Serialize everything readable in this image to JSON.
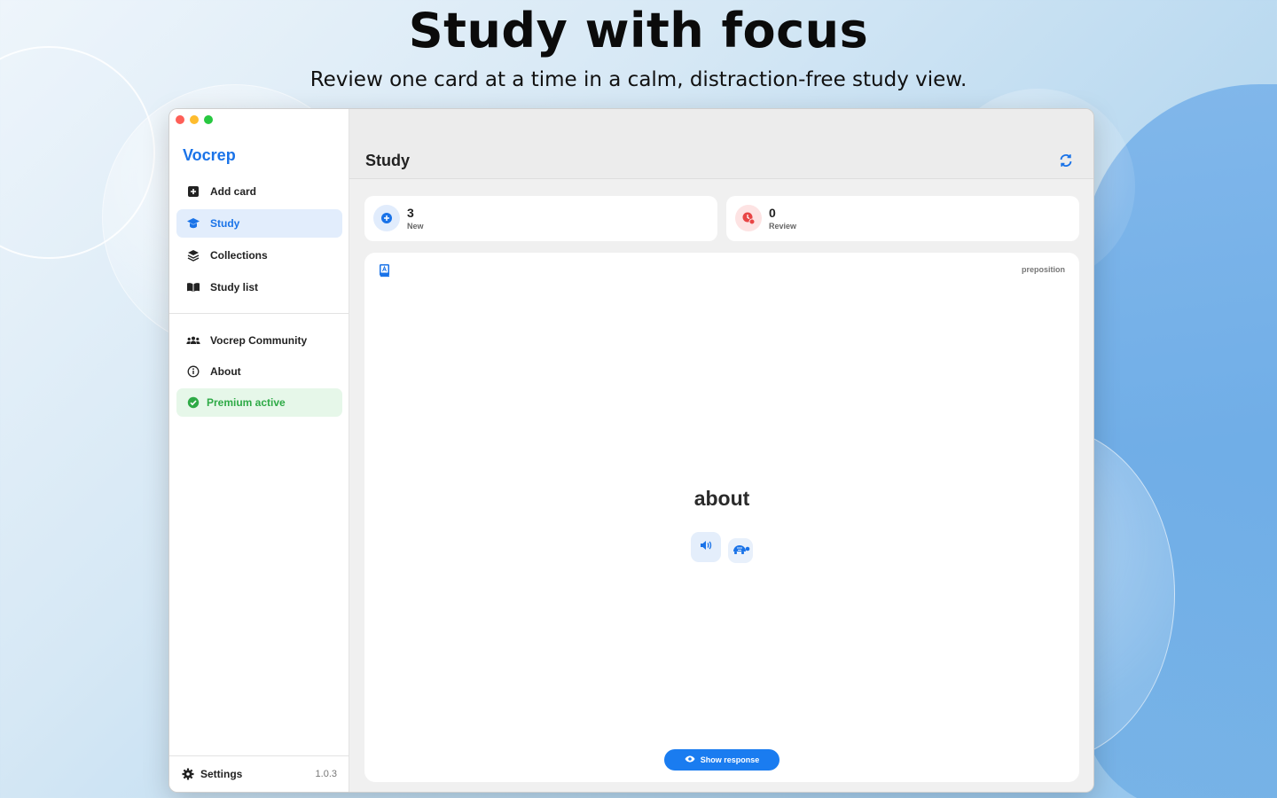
{
  "hero": {
    "title": "Study with focus",
    "subtitle": "Review one card at a time in a calm, distraction-free study view."
  },
  "sidebar": {
    "brand": "Vocrep",
    "items": [
      {
        "label": "Add card",
        "icon": "add-card-icon"
      },
      {
        "label": "Study",
        "icon": "graduation-cap-icon",
        "active": true
      },
      {
        "label": "Collections",
        "icon": "layers-icon"
      },
      {
        "label": "Study list",
        "icon": "open-book-icon"
      }
    ],
    "secondary_items": [
      {
        "label": "Vocrep Community",
        "icon": "people-icon"
      },
      {
        "label": "About",
        "icon": "info-icon"
      },
      {
        "label": "Premium active",
        "icon": "check-badge-icon"
      }
    ],
    "footer": {
      "settings_label": "Settings",
      "version": "1.0.3"
    }
  },
  "main": {
    "title": "Study",
    "stats": [
      {
        "value": "3",
        "label": "New",
        "color": "#1a73e8"
      },
      {
        "value": "0",
        "label": "Review",
        "color": "#e84545"
      }
    ],
    "card": {
      "part_of_speech": "preposition",
      "word": "about",
      "show_response_label": "Show response"
    }
  },
  "colors": {
    "accent": "#1a73e8",
    "premium": "#2eaa46",
    "review": "#e84545"
  }
}
